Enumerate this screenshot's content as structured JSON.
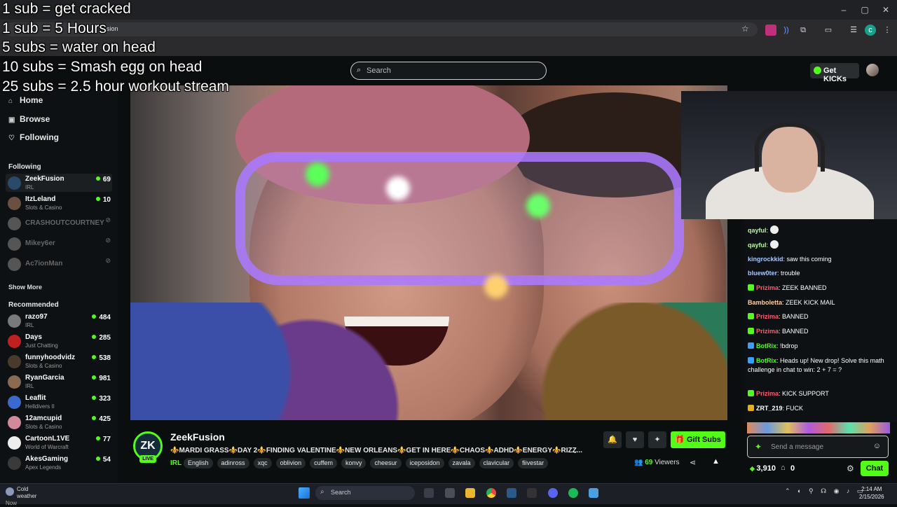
{
  "overlay_lines": [
    "1 sub = get cracked",
    "1 sub = 5 Hours",
    "5 subs = water on head",
    "10 subs = Smash egg on head",
    "25 subs = 2.5 hour workout stream"
  ],
  "browser": {
    "tab_fragment": "sion"
  },
  "header": {
    "search_placeholder": "Search",
    "get_kicks": "Get KICKs"
  },
  "nav": {
    "home": "Home",
    "browse": "Browse",
    "following": "Following"
  },
  "following_title": "Following",
  "following": [
    {
      "name": "ZeekFusion",
      "category": "IRL",
      "viewers": "69",
      "live": true,
      "color": "#2a4a6a"
    },
    {
      "name": "ItzLeland",
      "category": "Slots & Casino",
      "viewers": "10",
      "live": true,
      "color": "#6a5040"
    },
    {
      "name": "CRASHOUTCOURTNEY",
      "category": "",
      "viewers": "⊘",
      "live": false,
      "color": "#555"
    },
    {
      "name": "Mikey6er",
      "category": "",
      "viewers": "⊘",
      "live": false,
      "color": "#555"
    },
    {
      "name": "Ac7ionMan",
      "category": "",
      "viewers": "⊘",
      "live": false,
      "color": "#555"
    }
  ],
  "show_more": "Show More",
  "recommended_title": "Recommended",
  "recommended": [
    {
      "name": "razo97",
      "category": "IRL",
      "viewers": "484",
      "color": "#7a7a7a"
    },
    {
      "name": "Days",
      "category": "Just Chatting",
      "viewers": "285",
      "color": "#c02020"
    },
    {
      "name": "funnyhoodvidz",
      "category": "Slots & Casino",
      "viewers": "538",
      "color": "#4a3a2a"
    },
    {
      "name": "RyanGarcia",
      "category": "IRL",
      "viewers": "981",
      "color": "#8a6a50"
    },
    {
      "name": "Leaflit",
      "category": "Helldivers II",
      "viewers": "323",
      "color": "#3a6ad0"
    },
    {
      "name": "12amcupid",
      "category": "Slots & Casino",
      "viewers": "425",
      "color": "#d08a9a"
    },
    {
      "name": "CartoonL1VE",
      "category": "World of Warcraft",
      "viewers": "77",
      "color": "#eee"
    },
    {
      "name": "AkesGaming",
      "category": "Apex Legends",
      "viewers": "54",
      "color": "#3a3a3a"
    }
  ],
  "chat": {
    "messages": [
      {
        "user": "qayful",
        "text": "",
        "color": "#b9f5a0",
        "badge": ""
      },
      {
        "user": "qayful",
        "text": "",
        "color": "#b9f5a0",
        "badge": ""
      },
      {
        "user": "kingrockkid",
        "text": "saw this coming",
        "color": "#a8c8ff",
        "badge": ""
      },
      {
        "user": "bluew0ter",
        "text": "trouble",
        "color": "#a8c8ff",
        "badge": ""
      },
      {
        "user": "Prizima",
        "text": "ZEEK BANNED",
        "color": "#ff5a6a",
        "badge": "#53fc18"
      },
      {
        "user": "Bamboletta",
        "text": "ZEEK KICK MAIL",
        "color": "#ffd0a0",
        "badge": ""
      },
      {
        "user": "Prizima",
        "text": "BANNED",
        "color": "#ff5a6a",
        "badge": "#53fc18"
      },
      {
        "user": "Prizima",
        "text": "BANNED",
        "color": "#ff5a6a",
        "badge": "#53fc18"
      },
      {
        "user": "BotRix",
        "text": "!bdrop",
        "color": "#53fc18",
        "badge": "#3aa0ff"
      },
      {
        "user": "BotRix",
        "text": "Heads up! New drop! Solve this math challenge in chat to win: 2 + 7 = ?",
        "color": "#53fc18",
        "badge": "#3aa0ff"
      },
      {
        "user": "Prizima",
        "text": "KICK SUPPORT",
        "color": "#ff5a6a",
        "badge": "#53fc18"
      },
      {
        "user": "ZRT_219",
        "text": "FUCK",
        "color": "#ffffff",
        "badge": "#e0b020"
      }
    ],
    "input_placeholder": "Send a message",
    "kicks_balance": "3,910",
    "bank_count": "0",
    "chat_button": "Chat"
  },
  "stream": {
    "streamer": "ZeekFusion",
    "live_label": "LIVE",
    "title": "⚜️MARDI GRASS⚜️DAY 2⚜️FINDING VALENTINE⚜️NEW ORLEANS⚜️GET IN HERE⚜️CHAOS⚜️ADHD⚜️ENERGY⚜️RIZZ...",
    "category": "IRL",
    "tags": [
      "English",
      "adinross",
      "xqc",
      "oblivion",
      "cuffem",
      "konvy",
      "cheesur",
      "iceposidon",
      "zavala",
      "clavicular",
      "fiivestar"
    ],
    "gift_subs": "Gift Subs",
    "viewers_count": "69",
    "viewers_label": "Viewers"
  },
  "taskbar": {
    "weather_title": "Cold weather",
    "weather_sub": "Now",
    "search": "Search",
    "time": "2:14 AM",
    "date": "2/15/2026"
  },
  "colors": {
    "accent": "#53fc18",
    "background": "#0b0e0f"
  }
}
